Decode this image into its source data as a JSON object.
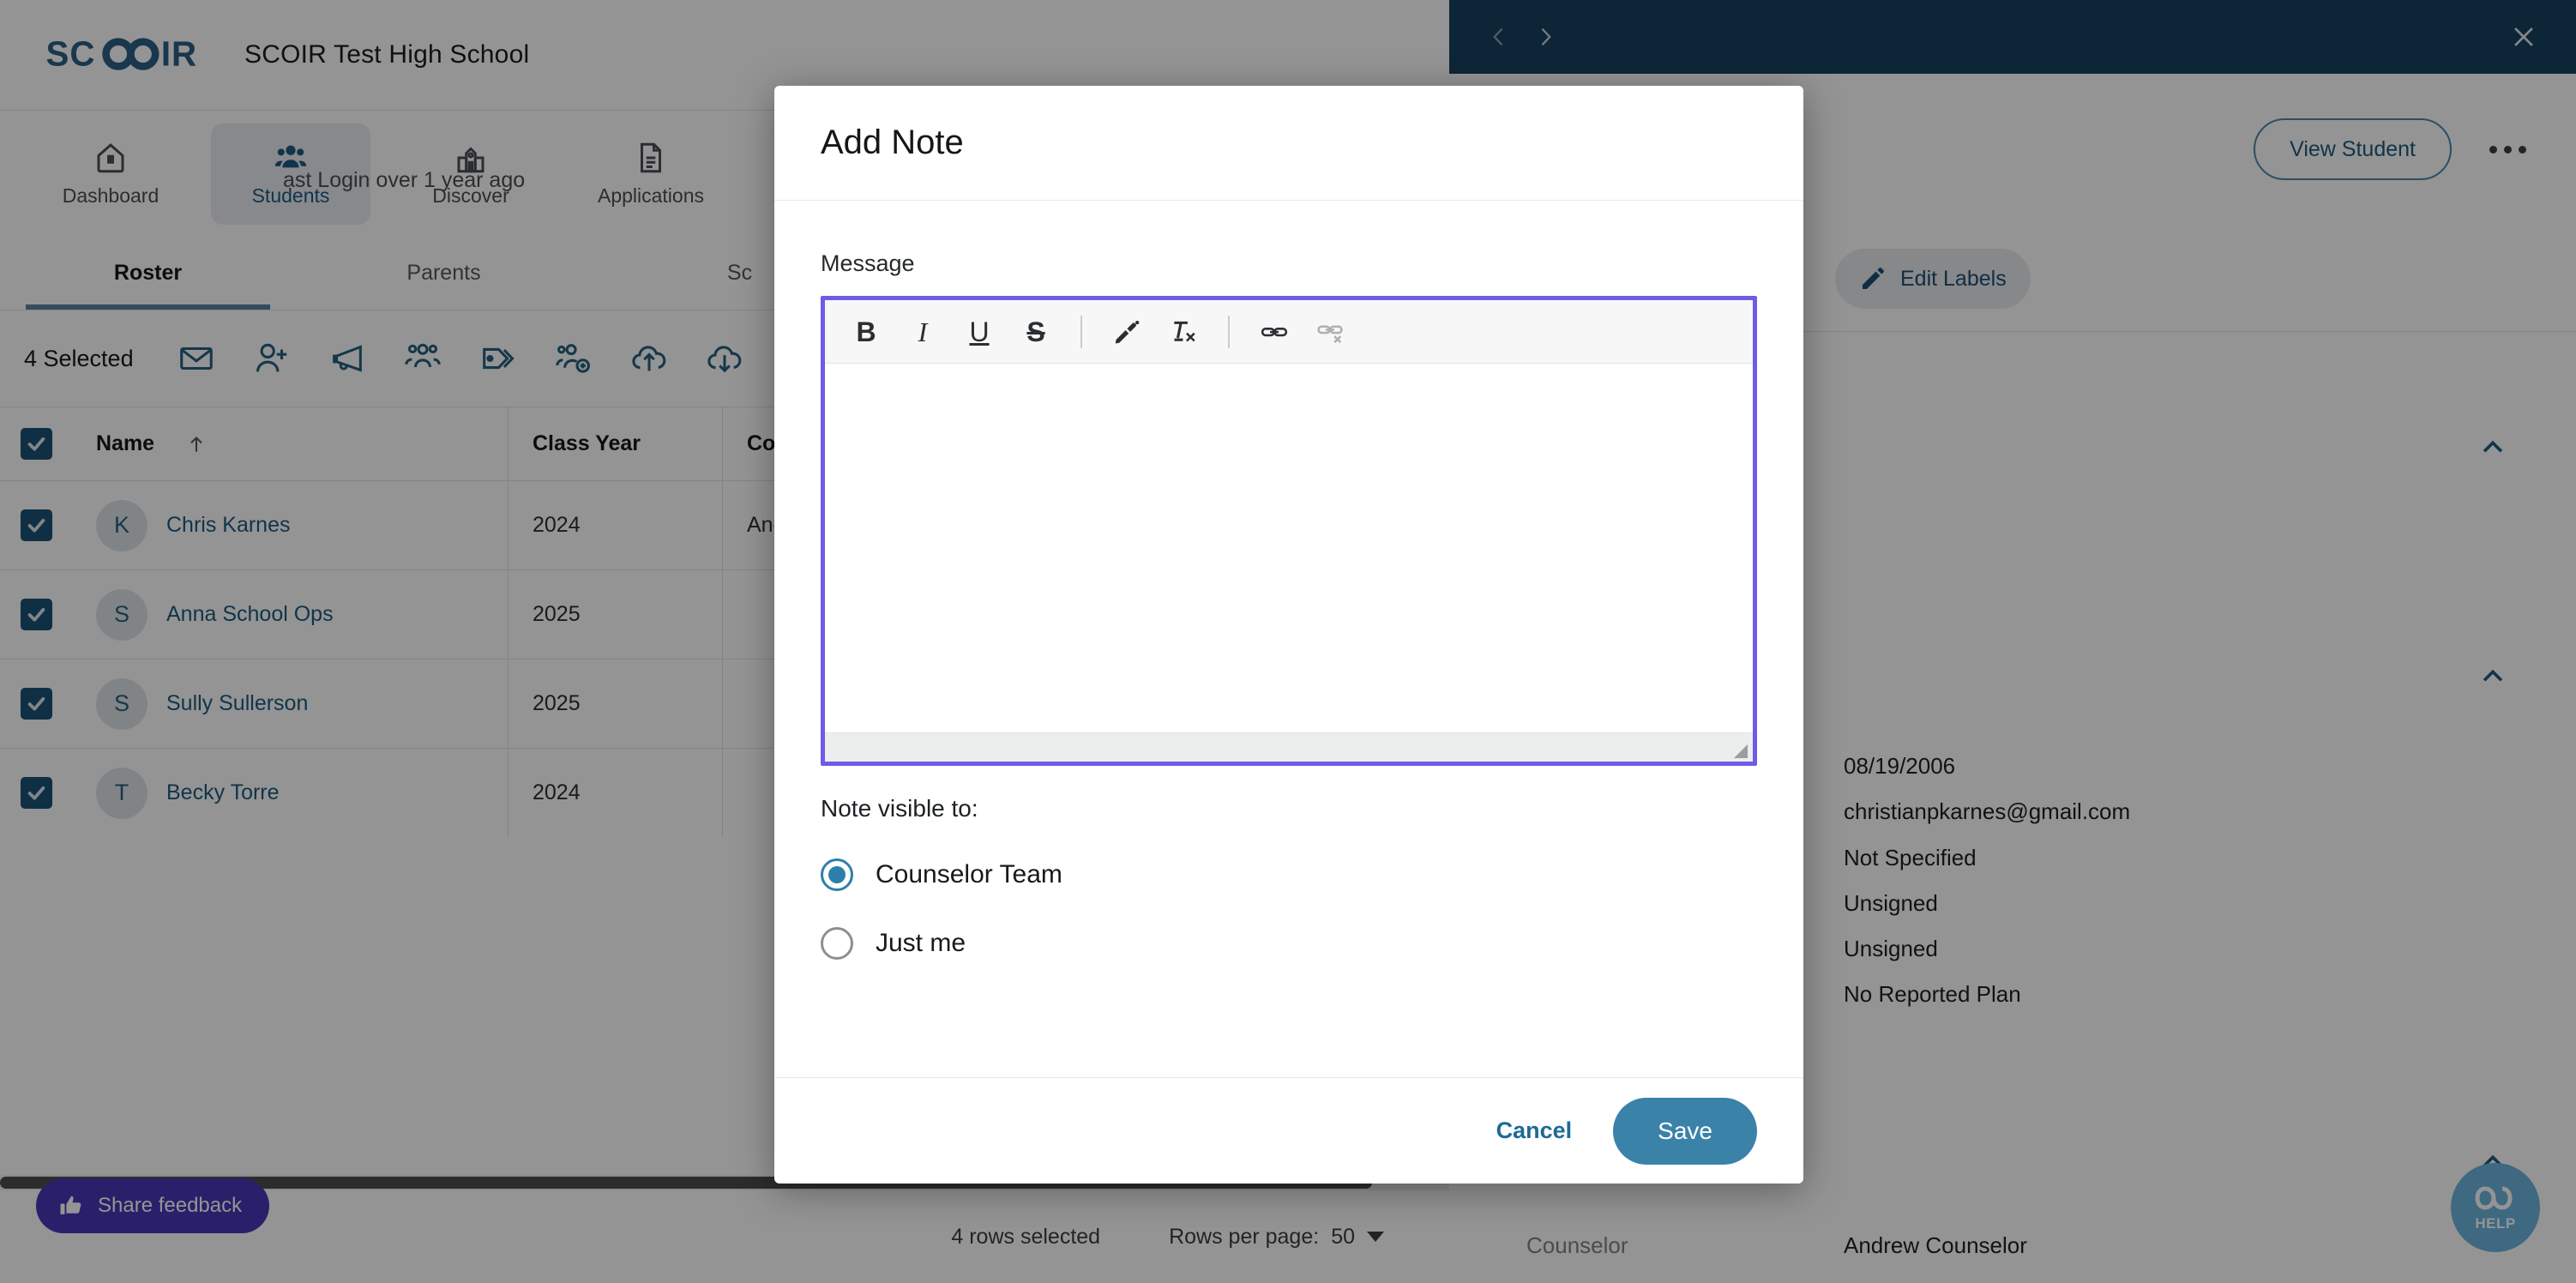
{
  "app": {
    "brand": {
      "logo_text": "SCOIR",
      "school_name": "SCOIR Test High School"
    },
    "primary_nav": [
      {
        "label": "Dashboard",
        "icon": "home-icon",
        "active": false
      },
      {
        "label": "Students",
        "icon": "people-icon",
        "active": true
      },
      {
        "label": "Discover",
        "icon": "school-building-icon",
        "active": false
      },
      {
        "label": "Applications",
        "icon": "document-icon",
        "active": false
      }
    ],
    "sub_tabs": [
      {
        "label": "Roster",
        "active": true
      },
      {
        "label": "Parents",
        "active": false
      },
      {
        "label": "Sc",
        "active": false
      }
    ],
    "bulk_bar": {
      "selected_label": "4 Selected",
      "actions": [
        {
          "name": "send-message-icon"
        },
        {
          "name": "add-student-icon"
        },
        {
          "name": "announcement-icon"
        },
        {
          "name": "groups-icon"
        },
        {
          "name": "label-tag-icon"
        },
        {
          "name": "assign-counselor-icon"
        },
        {
          "name": "upload-icon"
        },
        {
          "name": "download-icon"
        }
      ]
    },
    "table": {
      "columns": [
        "Name",
        "Class Year",
        "Coun"
      ],
      "sort_column": "Name",
      "sort_direction": "asc",
      "header_checkbox_checked": true,
      "rows": [
        {
          "checked": true,
          "initial": "K",
          "name": "Chris Karnes",
          "class_year": "2024",
          "counselor": "Andr"
        },
        {
          "checked": true,
          "initial": "S",
          "name": "Anna School Ops",
          "class_year": "2025",
          "counselor": ""
        },
        {
          "checked": true,
          "initial": "S",
          "name": "Sully Sullerson",
          "class_year": "2025",
          "counselor": ""
        },
        {
          "checked": true,
          "initial": "T",
          "name": "Becky Torre",
          "class_year": "2024",
          "counselor": ""
        }
      ]
    },
    "footer": {
      "rows_selected": "4 rows selected",
      "rows_per_page_label": "Rows per page:",
      "rows_per_page_value": "50"
    },
    "feedback_button": "Share feedback"
  },
  "detail_panel": {
    "last_login": "ast Login over 1 year ago",
    "view_student_label": "View Student",
    "edit_labels_label": "Edit Labels",
    "values": [
      "08/19/2006",
      "christianpkarnes@gmail.com",
      "Not Specified",
      "Unsigned",
      "Unsigned",
      "No Reported Plan"
    ],
    "counselor_label": "Counselor",
    "counselor_value": "Andrew Counselor",
    "help_label": "HELP"
  },
  "modal": {
    "title": "Add Note",
    "message_label": "Message",
    "message_value": "",
    "toolbar": [
      {
        "name": "bold-icon",
        "glyph": "B",
        "disabled": false
      },
      {
        "name": "italic-icon",
        "glyph": "I",
        "disabled": false
      },
      {
        "name": "underline-icon",
        "glyph": "U",
        "disabled": false
      },
      {
        "name": "strikethrough-icon",
        "glyph": "S",
        "disabled": false
      },
      {
        "name": "format-painter-icon",
        "glyph": "",
        "disabled": false
      },
      {
        "name": "remove-format-icon",
        "glyph": "",
        "disabled": false
      },
      {
        "name": "insert-link-icon",
        "glyph": "",
        "disabled": false
      },
      {
        "name": "unlink-icon",
        "glyph": "",
        "disabled": true
      }
    ],
    "visibility_label": "Note visible to:",
    "options": [
      {
        "label": "Counselor Team",
        "selected": true
      },
      {
        "label": "Just me",
        "selected": false
      }
    ],
    "cancel_label": "Cancel",
    "save_label": "Save"
  },
  "colors": {
    "brand_blue": "#1b5277",
    "accent_blue": "#3b82a9",
    "focus_purple": "#6C5CE7",
    "feedback_purple": "#4738b8",
    "panel_header": "#17435f",
    "help_blue": "#6cb6dd"
  }
}
